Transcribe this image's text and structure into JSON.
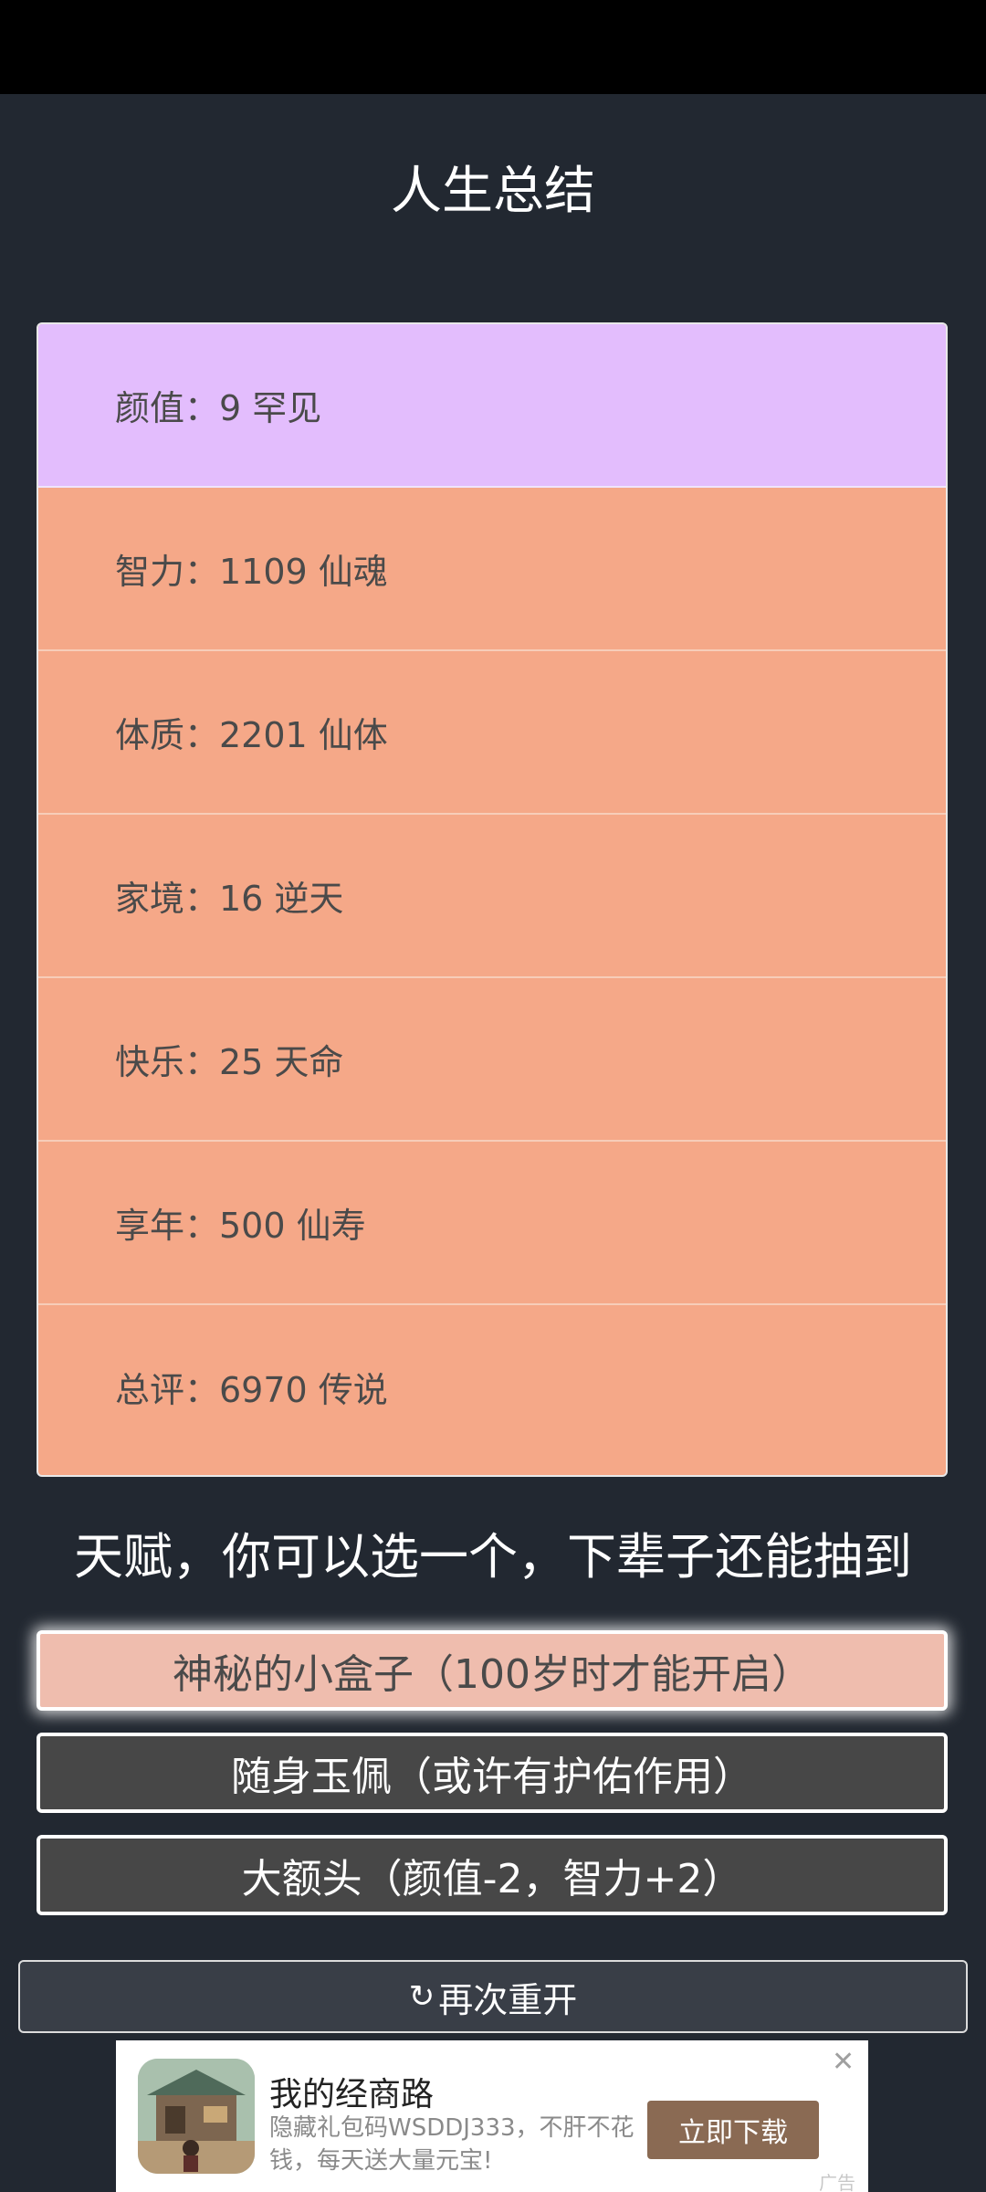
{
  "page": {
    "title": "人生总结"
  },
  "summary": {
    "rows": [
      {
        "label": "颜值：9 罕见"
      },
      {
        "label": "智力：1109 仙魂"
      },
      {
        "label": "体质：2201 仙体"
      },
      {
        "label": "家境：16 逆天"
      },
      {
        "label": "快乐：25 天命"
      },
      {
        "label": "享年：500 仙寿"
      },
      {
        "label": "总评：6970 传说"
      }
    ]
  },
  "talents": {
    "heading": "天赋，你可以选一个，下辈子还能抽到",
    "options": [
      {
        "label": "神秘的小盒子（100岁时才能开启）",
        "selected": true
      },
      {
        "label": "随身玉佩（或许有护佑作用）",
        "selected": false
      },
      {
        "label": "大额头（颜值-2，智力+2）",
        "selected": false
      }
    ]
  },
  "restart": {
    "label": "再次重开",
    "icon": "refresh-icon"
  },
  "ad": {
    "title": "我的经商路",
    "description": "隐藏礼包码WSDDJ333，不肝不花钱，每天送大量元宝!",
    "cta": "立即下载",
    "close": "✕",
    "label": "广告"
  },
  "colors": {
    "background": "#222831",
    "rare_row": "#e3bdfd",
    "row": "#f5a888",
    "selected_option": "#efbdae",
    "option": "#474747"
  }
}
